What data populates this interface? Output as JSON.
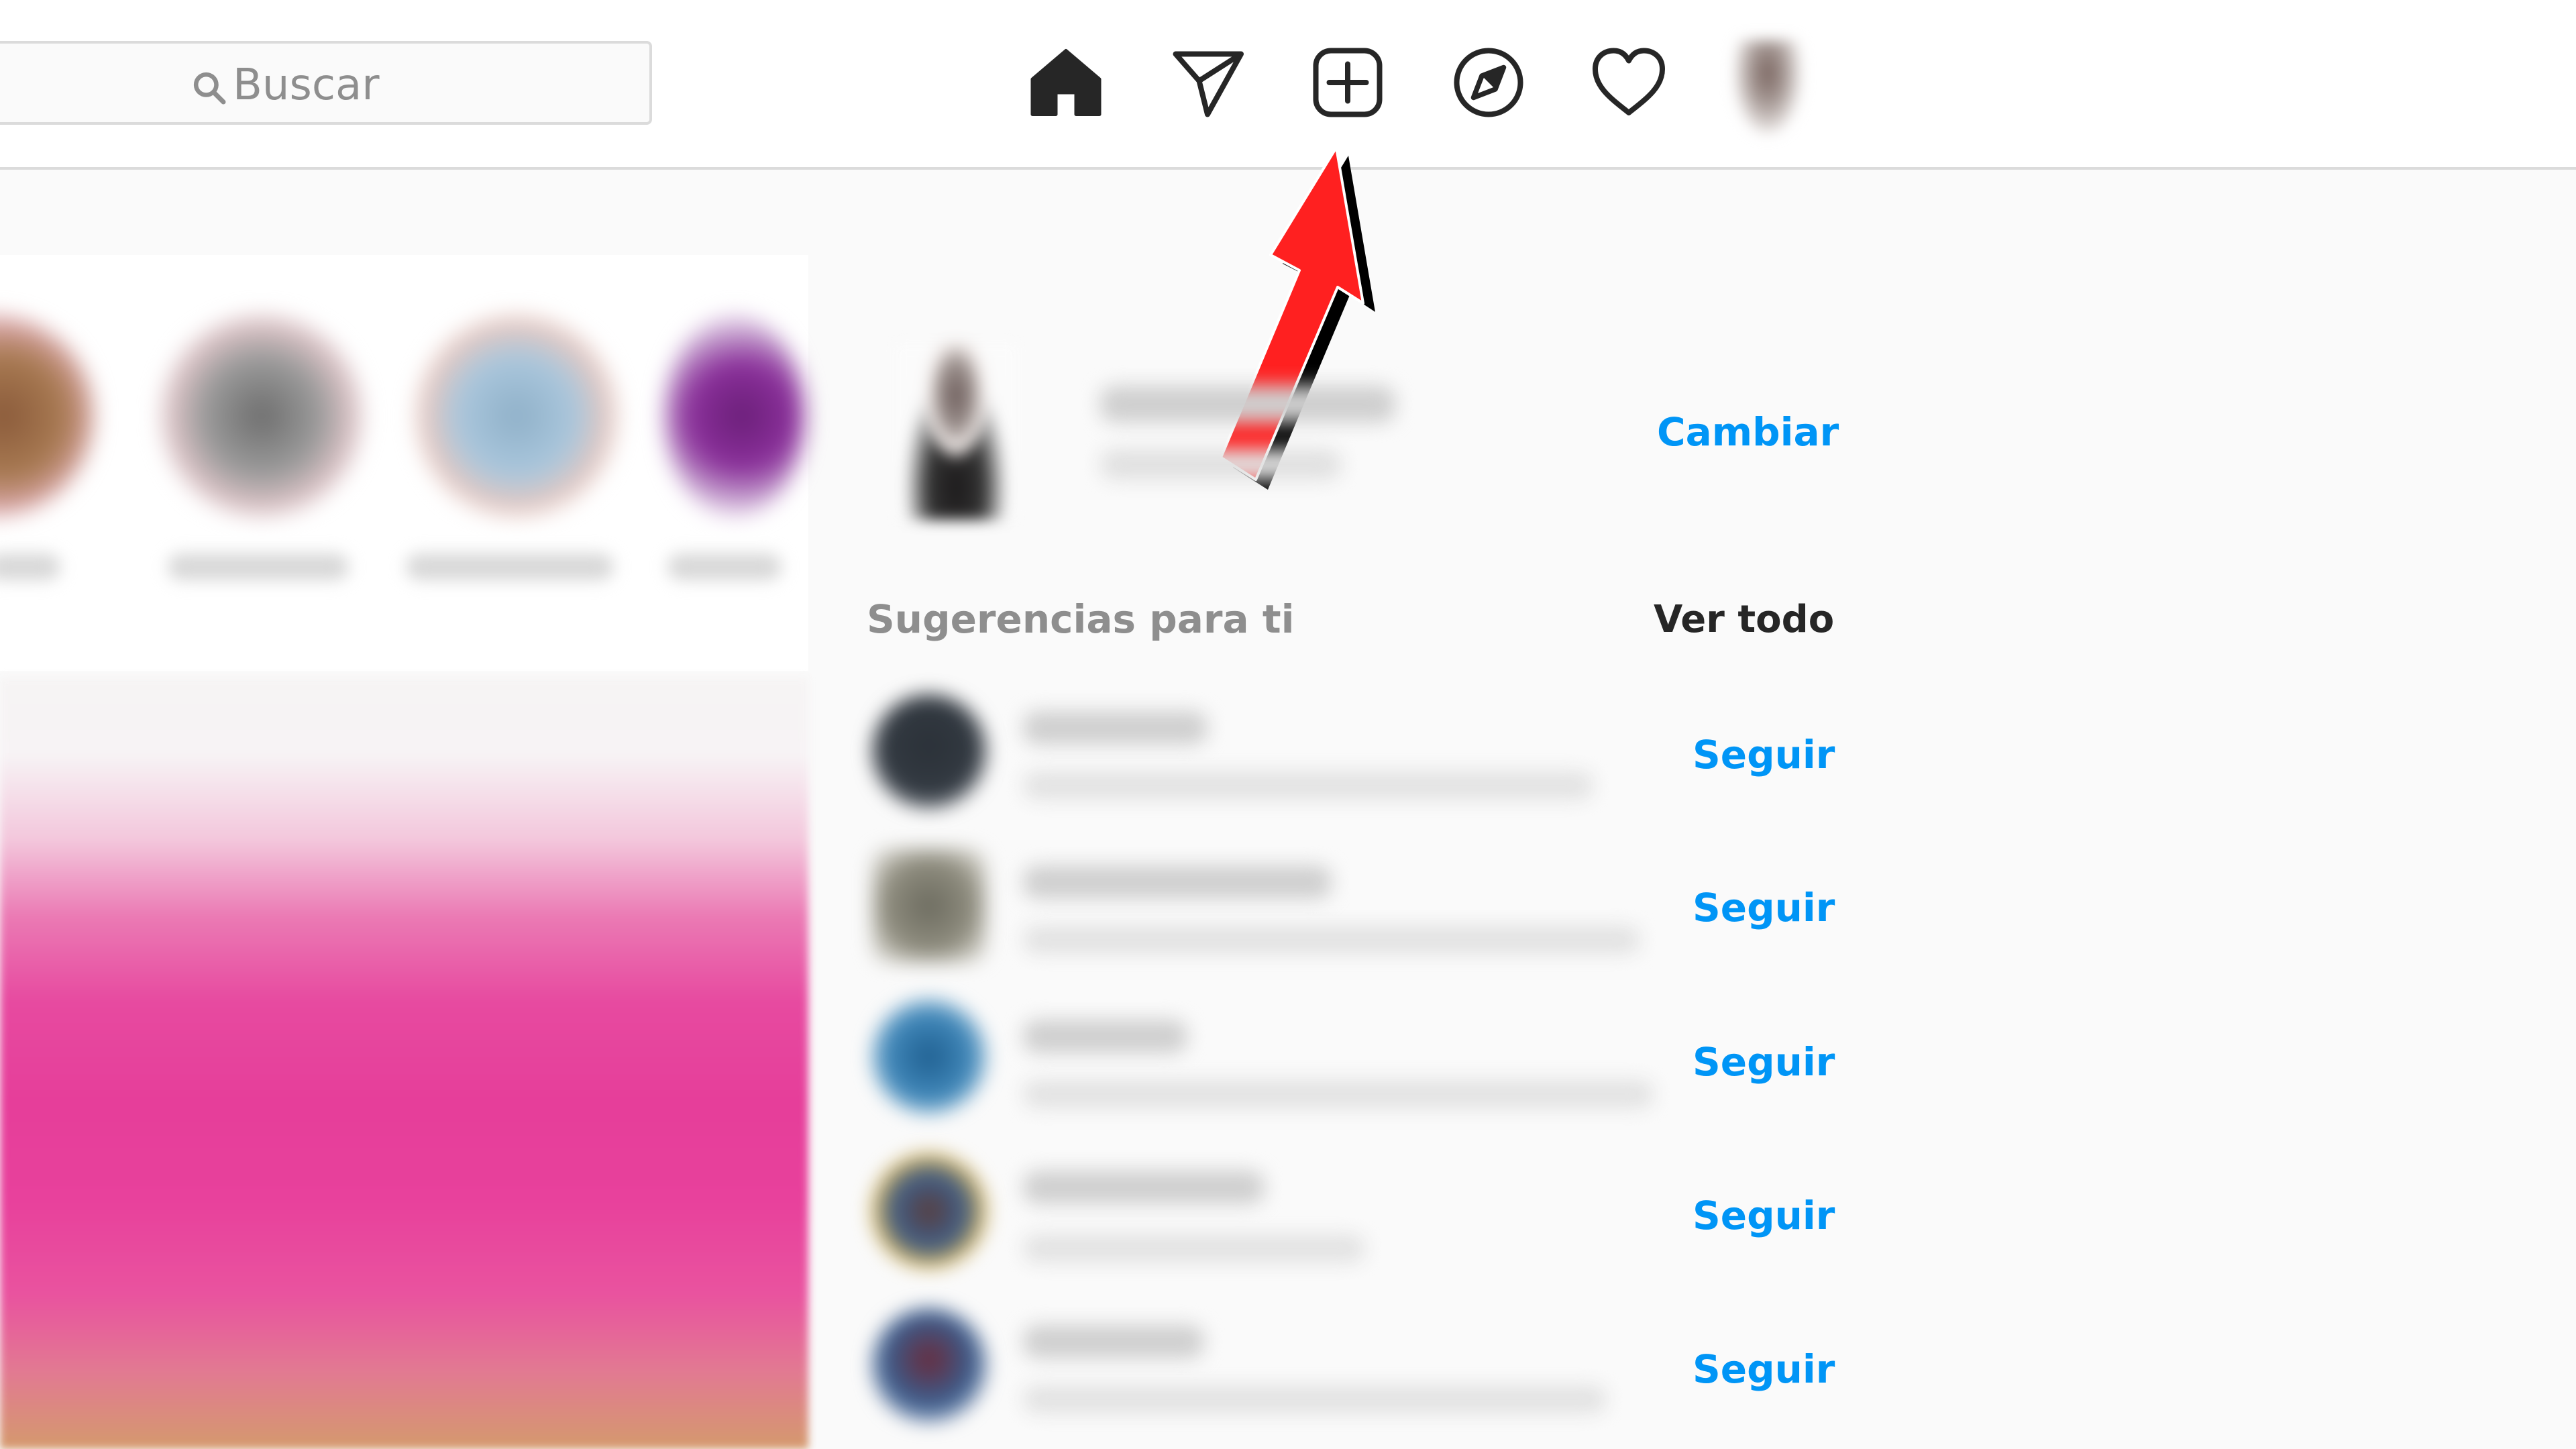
{
  "header": {
    "search_placeholder": "Buscar",
    "nav_icons": [
      "home-icon",
      "send-icon",
      "new-post-icon",
      "explore-icon",
      "heart-icon",
      "profile-avatar"
    ]
  },
  "sidebar": {
    "switch_label": "Cambiar",
    "suggestions_title": "Sugerencias para ti",
    "see_all_label": "Ver todo",
    "suggestions": [
      {
        "follow_label": "Seguir"
      },
      {
        "follow_label": "Seguir"
      },
      {
        "follow_label": "Seguir"
      },
      {
        "follow_label": "Seguir"
      },
      {
        "follow_label": "Seguir"
      }
    ]
  },
  "colors": {
    "accent": "#0095f6",
    "annotation_arrow": "#ff2020",
    "muted_text": "#8e8e8e",
    "border": "#dbdbdb"
  }
}
